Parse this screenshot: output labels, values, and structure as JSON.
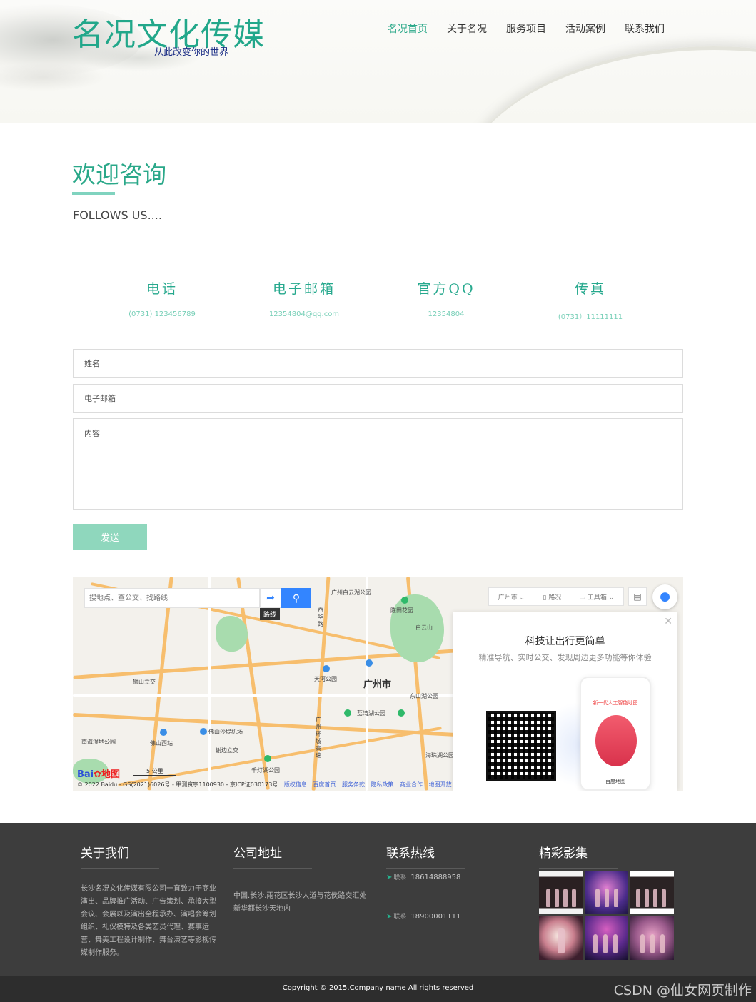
{
  "header": {
    "logo_title": "名况文化传媒",
    "logo_subtitle": "从此改变你的世界",
    "nav": [
      {
        "label": "名况首页",
        "active": true
      },
      {
        "label": "关于名况",
        "active": false
      },
      {
        "label": "服务项目",
        "active": false
      },
      {
        "label": "活动案例",
        "active": false
      },
      {
        "label": "联系我们",
        "active": false
      }
    ]
  },
  "welcome": {
    "title": "欢迎咨询",
    "subtitle": "FOLLOWS US...."
  },
  "contacts": [
    {
      "label": "电话",
      "value": "(0731) 123456789"
    },
    {
      "label": "电子邮箱",
      "value": "12354804@qq.com"
    },
    {
      "label": "官方QQ",
      "value": "12354804"
    },
    {
      "label": "传真",
      "value": "(0731）11111111"
    }
  ],
  "form": {
    "name_placeholder": "姓名",
    "email_placeholder": "电子邮箱",
    "content_placeholder": "内容",
    "send_label": "发送"
  },
  "map": {
    "search_placeholder": "搜地点、查公交、找路线",
    "route_tooltip": "路线",
    "city_select": "广州市",
    "traffic_label": "路况",
    "toolbox_label": "工具箱",
    "city_name": "广州市",
    "labels": [
      "广州白云湖公园",
      "陈田花园",
      "白云山",
      "狮山立交",
      "天河公园",
      "荔湾湖公园",
      "东山湖公园",
      "佛山沙堤机场",
      "南海湿地公园",
      "佛山西站",
      "谢边立交",
      "千灯湖公园",
      "海珠湖公园",
      "广州环城高速",
      "西华路"
    ],
    "logo": "Bai",
    "logo_suffix": "地图",
    "scale": "5 公里",
    "copyright": "© 2022 Baidu - GS(2021)6026号 - 甲测资字1100930 - 京ICP证030173号",
    "links": [
      "版权信息",
      "百度首页",
      "服务条款",
      "隐私政策",
      "商业合作",
      "地图开放"
    ],
    "promo_title": "科技让出行更简单",
    "promo_subtitle": "精准导航、实时公交、发现周边更多功能等你体验",
    "promo_phone_title": "新一代人工智能地图",
    "promo_phone_brand": "百度地图"
  },
  "footer": {
    "about_title": "关于我们",
    "about_text": "长沙名况文化传媒有限公司一直致力于商业演出、品牌推广活动、广告策划、承接大型会议、会展以及演出全程承办、演唱会筹划组织、礼仪模特及各类艺员代理、赛事运营、舞美工程设计制作、舞台演艺等影视传媒制作服务。",
    "address_title": "公司地址",
    "address_text": "中国.长沙.雨花区长沙大道与花侯路交汇处新华都长沙天地内",
    "hotline_title": "联系热线",
    "hotlines": [
      {
        "label": "联系",
        "number": "18614888958"
      },
      {
        "label": "联系",
        "number": "18900001111"
      }
    ],
    "gallery_title": "精彩影集"
  },
  "copyright": "Copyright © 2015.Company name All rights reserved",
  "watermark": "CSDN @仙女网页制作",
  "colors": {
    "accent": "#2aa889",
    "button": "#8fd7bd",
    "footer_bg": "#3d3d3d",
    "bottom_bar": "#2d2d2d"
  }
}
